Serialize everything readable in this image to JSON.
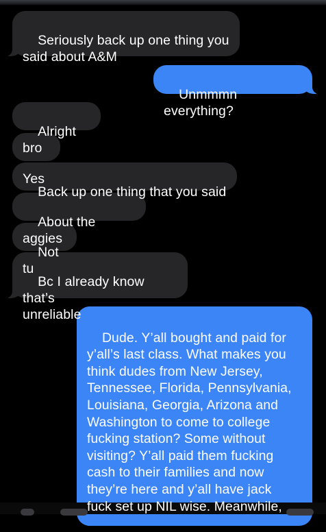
{
  "messages": [
    {
      "id": "m1",
      "direction": "received",
      "text": "Seriously back up one thing you\nsaid about A&M"
    },
    {
      "id": "m2",
      "direction": "sent",
      "text": "Unmmmn everything?"
    },
    {
      "id": "m3",
      "direction": "received",
      "text": "Alright bro"
    },
    {
      "id": "m4",
      "direction": "received",
      "text": "Yes"
    },
    {
      "id": "m5",
      "direction": "received",
      "text": "Back up one thing that you said"
    },
    {
      "id": "m6",
      "direction": "received",
      "text": "About the aggies"
    },
    {
      "id": "m7",
      "direction": "received",
      "text": "Not tu"
    },
    {
      "id": "m8",
      "direction": "received",
      "text": "Bc I already know that’s\nunreliable"
    },
    {
      "id": "m9",
      "direction": "sent",
      "text": "Dude. Y’all bought and paid for\ny’all’s last class. What makes you\nthink dudes from New Jersey,\nTennessee, Florida, Pennsylvania,\nLouisiana, Georgia, Arizona and\nWashington to come to college\nfucking station? Some without\nvisiting? Y’all paid them fucking\ncash to their families and now\nthey’re here and y’all have jack\nfuck set up NIL wise. Meanwhile,"
    }
  ],
  "colors": {
    "background": "#000000",
    "received_bubble": "#262628",
    "sent_bubble": "#3c85f6",
    "text": "#ffffff"
  }
}
